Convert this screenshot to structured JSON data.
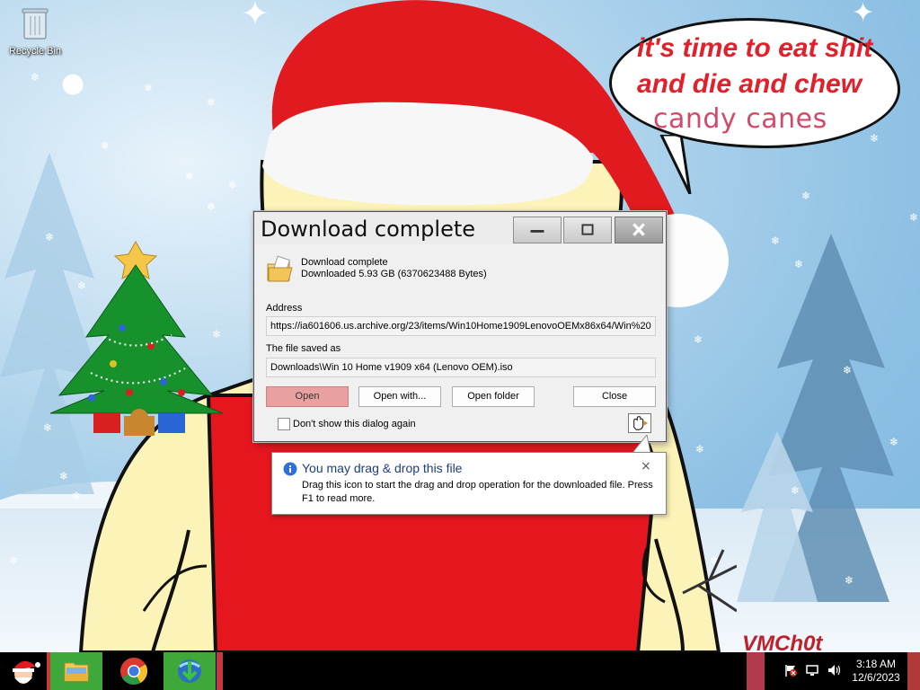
{
  "desktop": {
    "icons": [
      {
        "label": "Recycle Bin",
        "icon": "recycle-bin-icon"
      }
    ],
    "wallpaper": {
      "speech_bubble": {
        "line1": "it's time to eat shit",
        "line2": "and die and chew",
        "line3": "candy canes"
      },
      "signature": "VMCh0t"
    }
  },
  "dialog": {
    "title": "Download complete",
    "status_heading": "Download complete",
    "status_detail": "Downloaded 5.93  GB (6370623488 Bytes)",
    "address_label": "Address",
    "address_value": "https://ia601606.us.archive.org/23/items/Win10Home1909LenovoOEMx86x64/Win%20",
    "saved_label": "The file saved as",
    "saved_value": "Downloads\\Win 10 Home v1909 x64 (Lenovo OEM).iso",
    "buttons": {
      "open": "Open",
      "open_with": "Open with...",
      "open_folder": "Open folder",
      "close": "Close"
    },
    "checkbox_label": "Don't show this dialog again",
    "checkbox_checked": false
  },
  "tooltip": {
    "title": "You may drag & drop this file",
    "body": "Drag this icon to start the drag and drop operation for the downloaded file. Press F1 to read more.",
    "close": "×"
  },
  "taskbar": {
    "items": [
      "santa-start-icon",
      "file-explorer-icon",
      "chrome-icon",
      "idm-icon"
    ],
    "tray_icons": [
      "action-center-flag-icon",
      "network-icon",
      "volume-icon"
    ],
    "time": "3:18 AM",
    "date": "12/6/2023"
  },
  "colors": {
    "bubble_text_red": "#e0202a",
    "candy_canes_text": "#d24a6a",
    "open_button": "#e8a0a0",
    "taskbar_green": "#3ea83a",
    "tooltip_title": "#1e3c82"
  }
}
